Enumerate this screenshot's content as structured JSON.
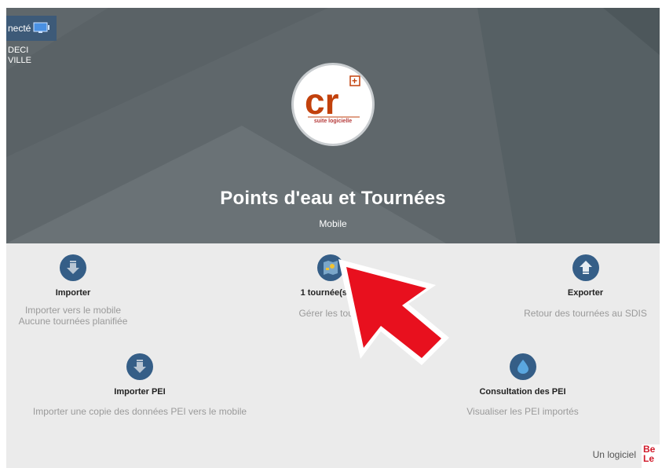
{
  "header": {
    "status_label": "necté",
    "org_line1": "DECI",
    "org_line2": "VILLE",
    "title": "Points d'eau et Tournées",
    "subtitle": "Mobile"
  },
  "logo": {
    "letters": "cr",
    "plus": "+",
    "subtitle": "suite logicielle"
  },
  "actions": {
    "import": {
      "label": "Importer",
      "desc1": "Importer vers le mobile",
      "desc2": "Aucune tournées planifiée",
      "icon": "arrow-down-icon"
    },
    "tours": {
      "label": "1 tournée(s) et",
      "desc": "Gérer les tourn",
      "icon": "map-icon"
    },
    "export": {
      "label": "Exporter",
      "desc": "Retour des tournées au SDIS",
      "icon": "arrow-up-icon"
    },
    "import_pei": {
      "label": "Importer PEI",
      "desc": "Importer une copie des données PEI vers le mobile",
      "icon": "arrow-down-icon"
    },
    "consult_pei": {
      "label": "Consultation des PEI",
      "desc": "Visualiser les PEI importés",
      "icon": "water-drop-icon"
    }
  },
  "footer": {
    "text": "Un logiciel",
    "brand1": "Be",
    "brand2": "Le"
  },
  "colors": {
    "accent": "#355e87",
    "hero": "#5f676b",
    "panel": "#ebebeb",
    "annotation": "#e8101e"
  }
}
